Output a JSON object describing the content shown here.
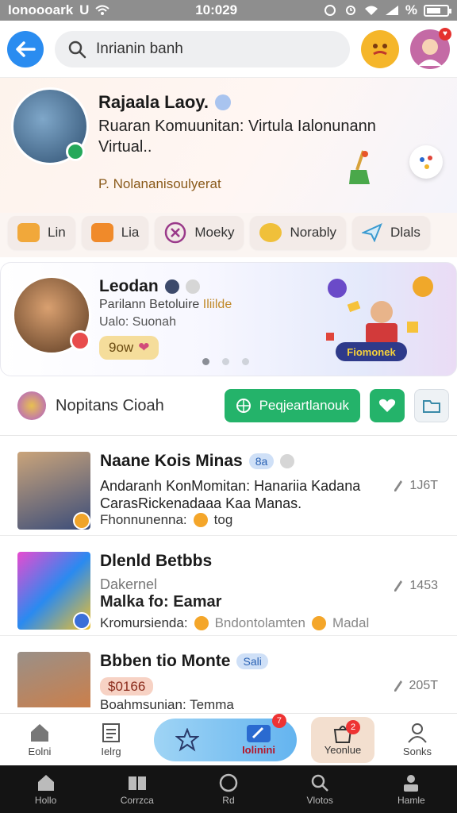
{
  "status_bar": {
    "carrier": "Ionoooark",
    "extra": "U",
    "time": "10:029",
    "percent": "%",
    "battery_level": 0.7
  },
  "top_bar": {
    "search_placeholder": "Inrianin banh"
  },
  "hero": {
    "name": "Rajaala Laoy.",
    "description": "Ruaran Komuunitan: Virtula Ialonunann Virtual..",
    "sub": "P. Nolananisoulyerat"
  },
  "chips": [
    {
      "label": "Lin",
      "color": "#f1a83a"
    },
    {
      "label": "Lia",
      "color": "#f08a2a"
    },
    {
      "label": "Moeky",
      "color": "#9a3a8a"
    },
    {
      "label": "Norably",
      "color": "#f0c03a"
    },
    {
      "label": "Dlals",
      "color": "#3a9ad0"
    }
  ],
  "banner": {
    "title": "Leodan",
    "line1_a": "Parilann ",
    "line1_b": "Betoluire ",
    "line1_c": "Iliilde",
    "line2": "Ualo: Suonah",
    "button": "9ow",
    "art_label": "Fiomonek"
  },
  "section": {
    "title": "Nopitans Cioah",
    "green_button": "Peqjeartlanouk"
  },
  "items": [
    {
      "title": "Naane Kois Minas",
      "tag": "8a",
      "desc": "Andaranh KonMomitan: Hanariia Kadana CarasRickenadaaa Kaa Manas.",
      "meta_label": "Fhonnunenna:",
      "meta_value": "tog",
      "stat": "1J6T"
    },
    {
      "title": "Dlenld Betbbs",
      "tag": "",
      "sub": "Dakernel",
      "desc": "Malka fo: Eamar",
      "meta_label": "Kromursienda:",
      "meta_value": "Bndontolamten",
      "meta_value2": "Madal",
      "stat": "1453"
    },
    {
      "title": "Bbben tio Monte",
      "tag": "Sali",
      "price": "$0166",
      "meta_label": "Boahmsunian: Temma",
      "stat": "205T"
    }
  ],
  "tabbar": {
    "home": "Eolni",
    "diary": "Ielrg",
    "center_badge": "7",
    "center_label": "Iolinini",
    "bag": "Yeonlue",
    "bag_badge": "2",
    "profile": "Sonks"
  },
  "sysnav": {
    "a": "Hollo",
    "b": "Corrzca",
    "c": "Rd",
    "d": "Vlotos",
    "e": "Hamle"
  }
}
